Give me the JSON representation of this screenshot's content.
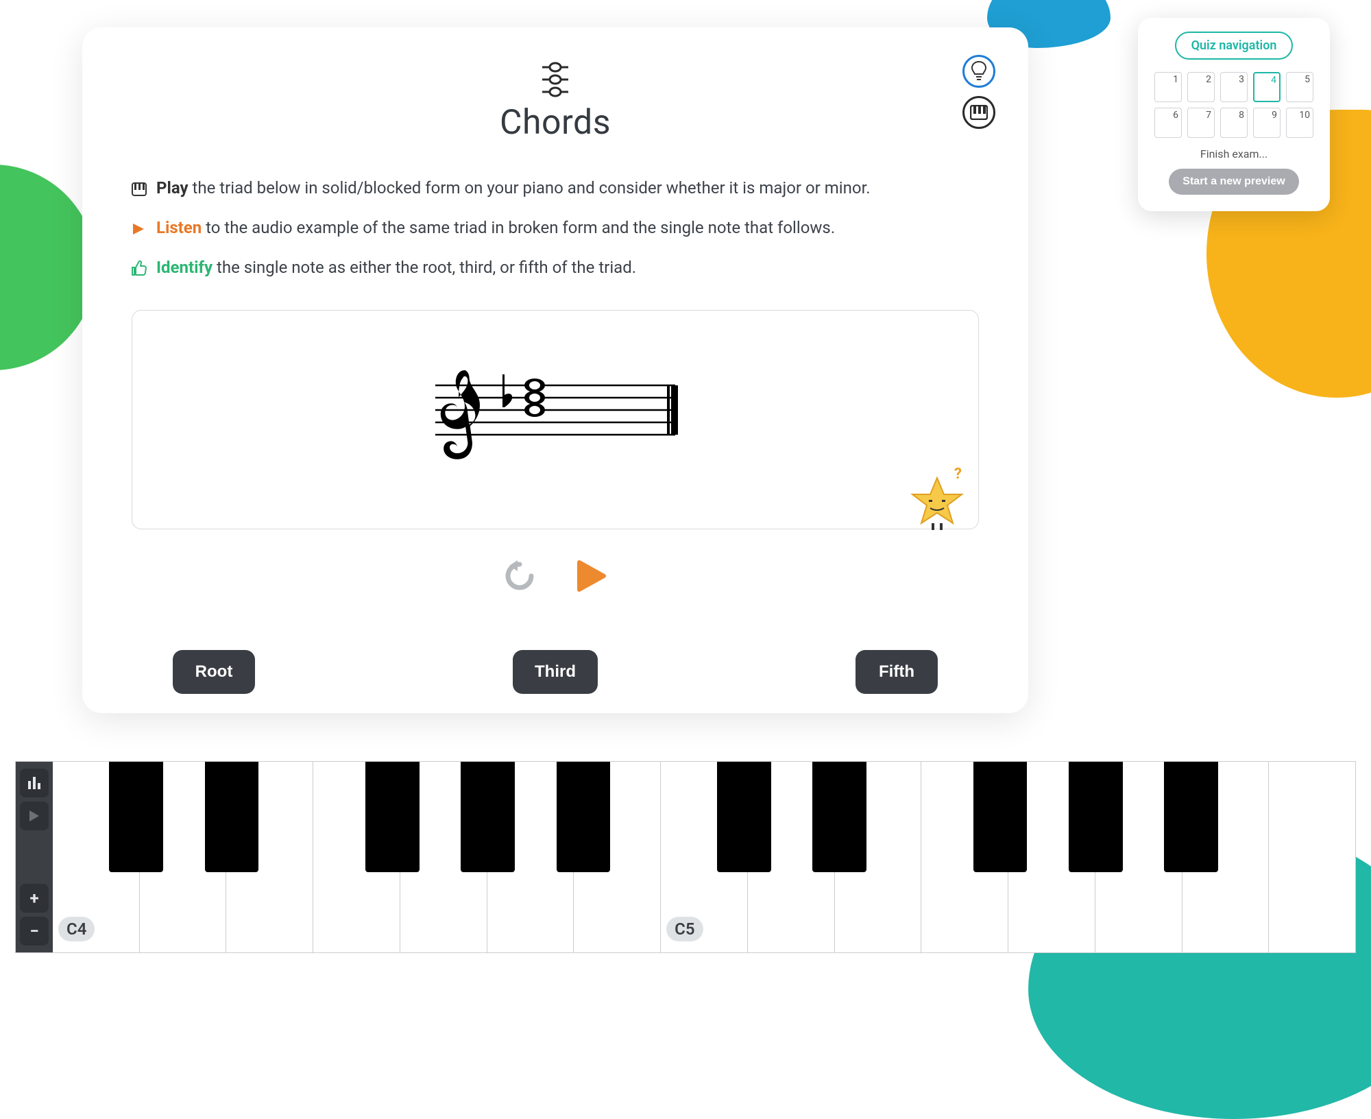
{
  "header": {
    "title": "Chords",
    "hint_icon": "lightbulb-icon",
    "keyboard_icon": "keyboard-icon"
  },
  "instructions": {
    "play": {
      "verb": "Play",
      "text": "the triad below in solid/blocked form on your piano and consider whether it is major or minor."
    },
    "listen": {
      "verb": "Listen",
      "text": "to the audio example of the same triad in broken form and the single note that follows."
    },
    "identify": {
      "verb": "Identify",
      "text": "the single note as either the root, third, or fifth of the triad."
    }
  },
  "playback": {
    "replay_label": "Replay",
    "play_label": "Play audio"
  },
  "answers": [
    {
      "label": "Root"
    },
    {
      "label": "Third"
    },
    {
      "label": "Fifth"
    }
  ],
  "nav": {
    "title": "Quiz navigation",
    "items": [
      "1",
      "2",
      "3",
      "4",
      "5",
      "6",
      "7",
      "8",
      "9",
      "10"
    ],
    "active_index": 3,
    "finish_label": "Finish exam...",
    "new_preview_label": "Start a new preview"
  },
  "piano": {
    "labels": {
      "c4": "C4",
      "c5": "C5"
    },
    "tools": {
      "settings": "settings",
      "play": "play",
      "zoom_in": "+",
      "zoom_out": "−"
    },
    "white_key_count": 15,
    "black_key_pattern": [
      0.066,
      0.133,
      0.266,
      0.333,
      0.4,
      0.533,
      0.6,
      0.733,
      0.8,
      0.866
    ]
  },
  "colors": {
    "accent_orange": "#e97826",
    "accent_green": "#2bb673",
    "accent_teal": "#1db7a6",
    "accent_blue": "#1f7ed6"
  }
}
